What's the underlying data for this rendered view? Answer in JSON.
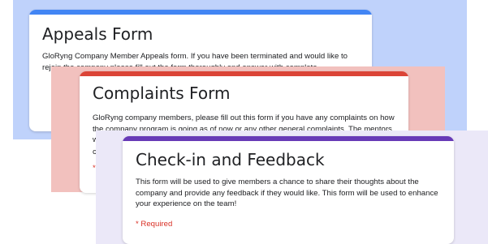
{
  "colors": {
    "appeals_panel": "#bfd2fb",
    "appeals_accent": "#4285f4",
    "complaints_panel": "#f2c1be",
    "complaints_accent": "#db4437",
    "checkin_panel": "#ebe8f8",
    "checkin_accent": "#673ab7"
  },
  "forms": [
    {
      "title": "Appeals Form",
      "description": "GloRyng Company Member Appeals form. If you have been terminated and would like to rejoin the company please fill out the form thoroughly and answer with complete"
    },
    {
      "title": "Complaints Form",
      "description": "GloRyng company members, please fill out this form if you have any complaints on how the company program is going as of now or any other general complaints. The mentors will fi",
      "description_line4": "c",
      "required_note": "*"
    },
    {
      "title": "Check-in and Feedback",
      "description": "This form will be used to give members a chance to share their thoughts about the company and provide any feedback if they would like. This form will be used to enhance your experience on the team!",
      "required_note": "* Required"
    }
  ]
}
